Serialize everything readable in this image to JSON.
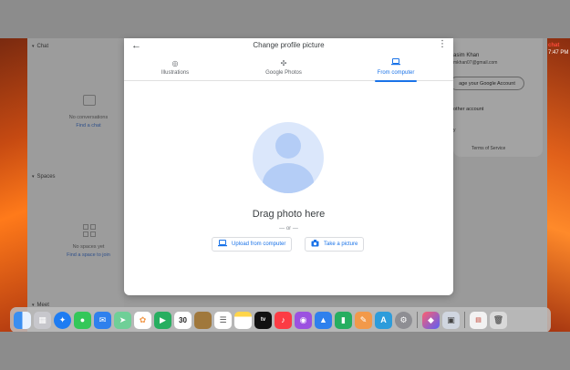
{
  "chat_app": {
    "chat_section": "Chat",
    "no_conversations": "No conversations",
    "find_chat": "Find a chat",
    "spaces_section": "Spaces",
    "no_spaces": "No spaces yet",
    "find_space": "Find a space to join",
    "meet_section": "Meet"
  },
  "account_popup": {
    "name": "asim Khan",
    "email": "mkhan07@gmail.com",
    "manage_label": "age your Google Account",
    "other_label": "other account",
    "privacy": "y",
    "terms": "Terms of Service"
  },
  "clock": {
    "line1": "chat",
    "line2": "7:47 PM"
  },
  "modal": {
    "title": "Change profile picture",
    "tabs": [
      {
        "label": "Illustrations",
        "icon": "palette-icon"
      },
      {
        "label": "Google Photos",
        "icon": "pinwheel-icon"
      },
      {
        "label": "From computer",
        "icon": "laptop-icon"
      }
    ],
    "drag_text": "Drag photo here",
    "or_text": "— or —",
    "upload_label": "Upload from computer",
    "take_picture_label": "Take a picture"
  },
  "dock": {
    "calendar_day": "30",
    "tv_label": "tv",
    "items": [
      "Finder",
      "Launchpad",
      "Safari",
      "Messages",
      "Mail",
      "Maps",
      "Photos",
      "FaceTime",
      "Calendar",
      "Notes-brown",
      "Reminders",
      "Notes",
      "Apple TV",
      "Music",
      "Podcasts",
      "Keynote",
      "Numbers",
      "Pages",
      "App Store",
      "System Preferences",
      "Shortcuts",
      "Preview",
      "Documents",
      "Trash"
    ]
  },
  "colors": {
    "accent": "#1a73e8",
    "text": "#3c4043"
  }
}
